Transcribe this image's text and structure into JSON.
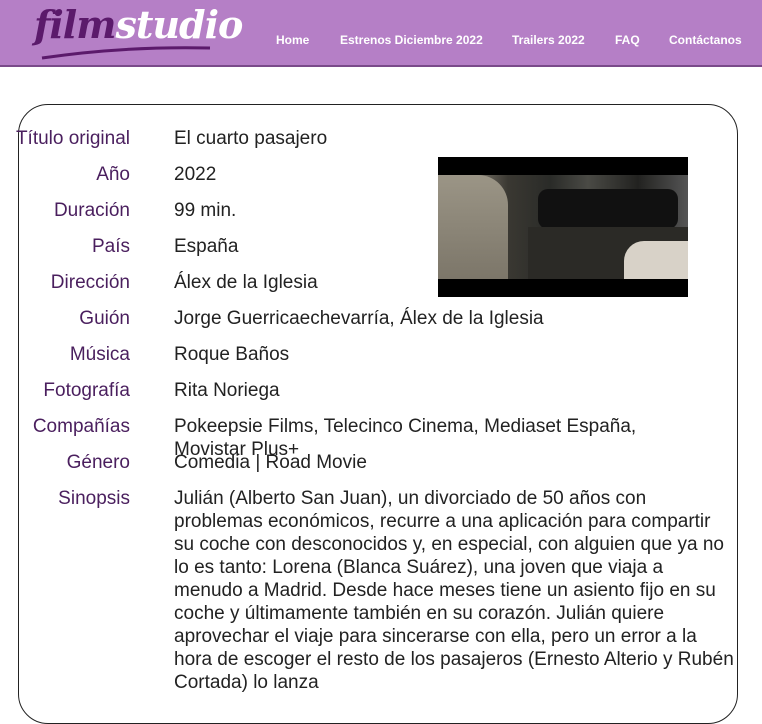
{
  "nav": {
    "logo_film": "film",
    "logo_studio": "studio",
    "items": [
      "Home",
      "Estrenos Diciembre 2022",
      "Trailers 2022",
      "FAQ",
      "Contáctanos"
    ]
  },
  "movie": {
    "rows": [
      {
        "label": "Título original",
        "value": "El cuarto pasajero"
      },
      {
        "label": "Año",
        "value": "2022"
      },
      {
        "label": "Duración",
        "value": "99 min."
      },
      {
        "label": "País",
        "value": "España"
      },
      {
        "label": "Dirección",
        "value": "Álex de la Iglesia"
      },
      {
        "label": "Guión",
        "value": "Jorge Guerricaechevarría, Álex de la Iglesia"
      },
      {
        "label": "Música",
        "value": "Roque Baños"
      },
      {
        "label": "Fotografía",
        "value": "Rita Noriega"
      },
      {
        "label": "Compañías",
        "value": "Pokeepsie Films, Telecinco Cinema, Mediaset España, Movistar Plus+"
      },
      {
        "label": "Género",
        "value": "Comedia | Road Movie"
      },
      {
        "label": "Sinopsis",
        "value": "Julián (Alberto San Juan), un divorciado de 50 años con problemas económicos, recurre a una aplicación para compartir su coche con desconocidos y, en especial, con alguien que ya no lo es tanto: Lorena (Blanca Suárez), una joven que viaja a menudo a Madrid. Desde hace meses tiene un asiento fijo en su coche y últimamente también en su corazón. Julián quiere aprovechar el viaje para sincerarse con ella, pero un error a la hora de escoger el resto de los pasajeros (Ernesto Alterio y Rubén Cortada) lo lanza"
      }
    ]
  }
}
